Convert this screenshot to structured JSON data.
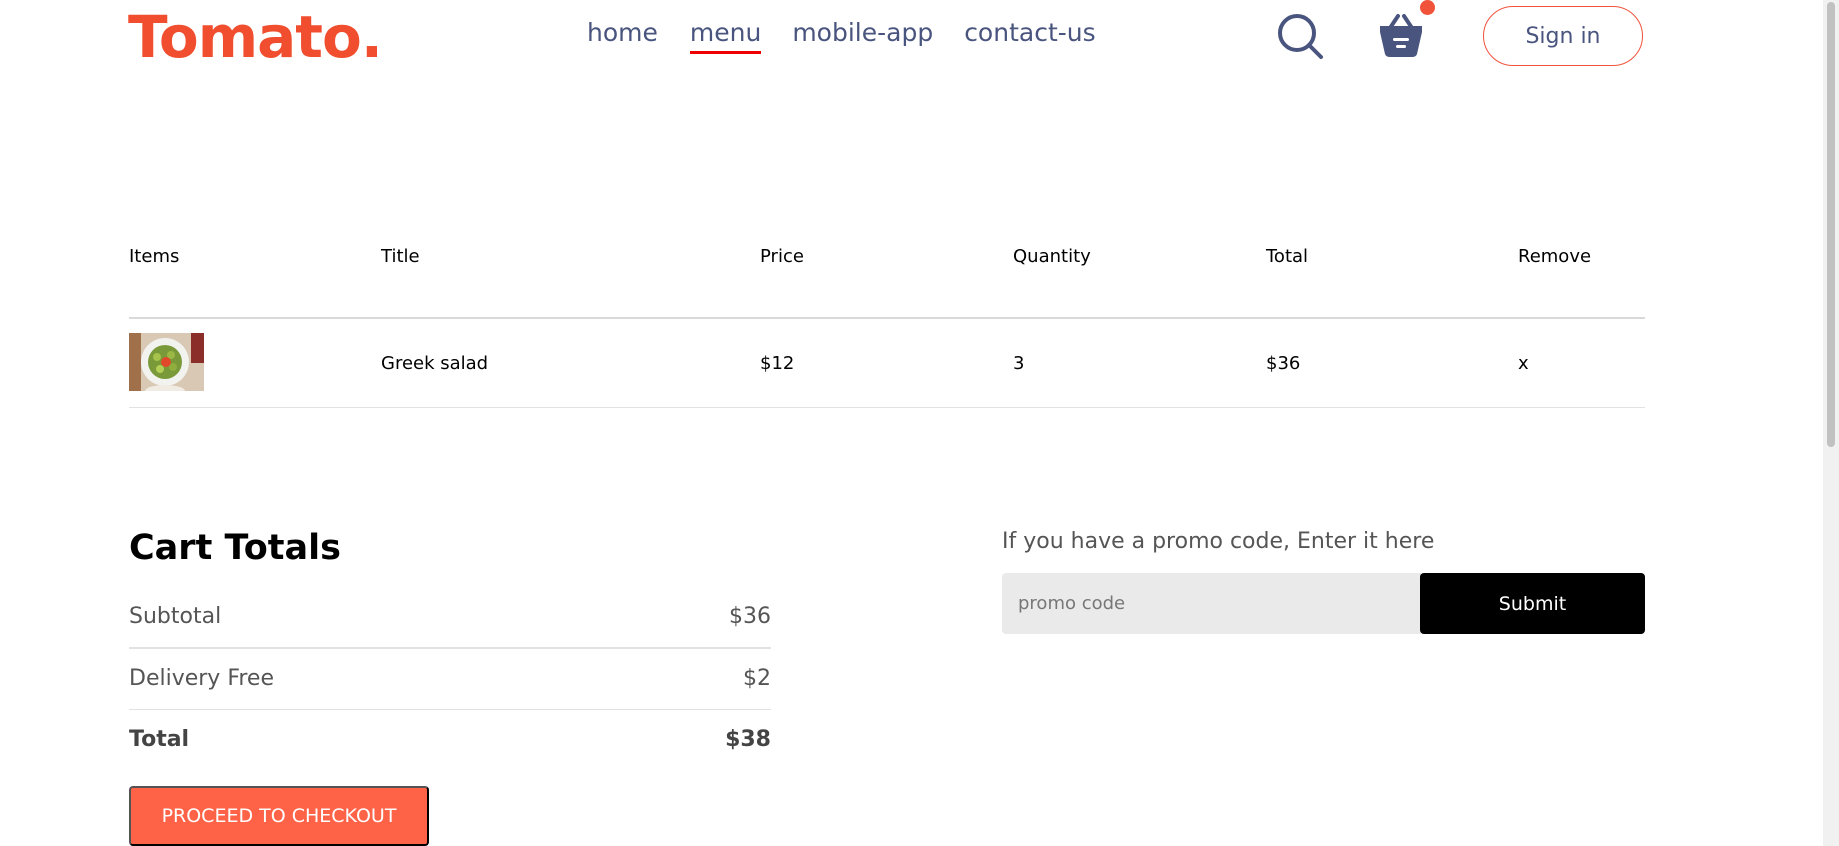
{
  "header": {
    "logo": "Tomato.",
    "nav": [
      {
        "label": "home",
        "active": false
      },
      {
        "label": "menu",
        "active": true
      },
      {
        "label": "mobile-app",
        "active": false
      },
      {
        "label": "contact-us",
        "active": false
      }
    ],
    "icons": {
      "search": "search-icon",
      "basket": "basket-icon"
    },
    "basket_has_items": true,
    "signin_label": "Sign in"
  },
  "cart_table": {
    "headers": [
      "Items",
      "Title",
      "Price",
      "Quantity",
      "Total",
      "Remove"
    ],
    "rows": [
      {
        "image": "greek-salad-thumbnail",
        "title": "Greek salad",
        "price": "$12",
        "quantity": "3",
        "total": "$36",
        "remove": "x"
      }
    ]
  },
  "cart_totals": {
    "title": "Cart Totals",
    "subtotal_label": "Subtotal",
    "subtotal_value": "$36",
    "delivery_label": "Delivery Free",
    "delivery_value": "$2",
    "total_label": "Total",
    "total_value": "$38",
    "checkout_label": "PROCEED TO CHECKOUT"
  },
  "promo": {
    "label": "If you have a promo code, Enter it here",
    "placeholder": "promo code",
    "value": "",
    "submit_label": "Submit"
  },
  "colors": {
    "brand": "#f04e2e",
    "nav_text": "#49557e",
    "checkout_button": "#ff6347",
    "submit_button": "#000000"
  }
}
